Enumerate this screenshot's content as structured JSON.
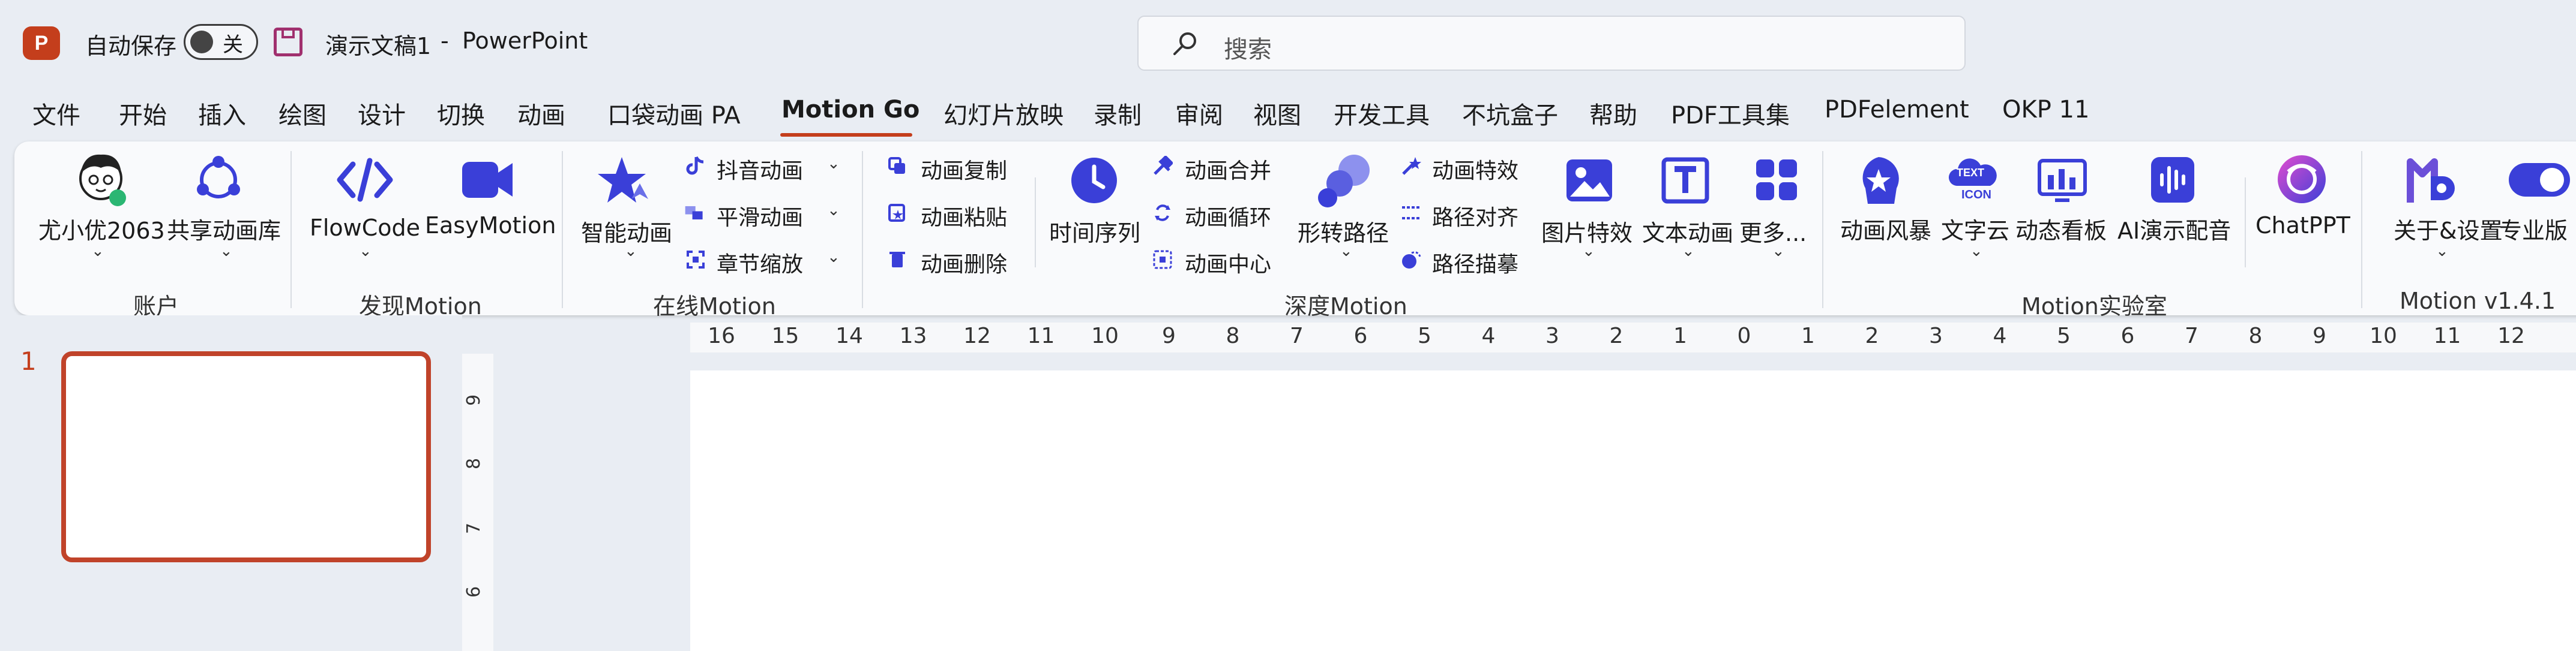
{
  "titlebar": {
    "logo_letter": "P",
    "autosave_label": "自动保存",
    "autosave_toggle": "关",
    "doc_title": "演示文稿1",
    "separator": "-",
    "app_name": "PowerPoint",
    "search_placeholder": "搜索"
  },
  "tabs": [
    "文件",
    "开始",
    "插入",
    "绘图",
    "设计",
    "切换",
    "动画",
    "口袋动画 PA",
    "Motion Go",
    "幻灯片放映",
    "录制",
    "审阅",
    "视图",
    "开发工具",
    "不坑盒子",
    "帮助",
    "PDF工具集",
    "PDFelement",
    "OKP 11"
  ],
  "active_tab": "Motion Go",
  "ribbon": {
    "account": {
      "user": "尤小优2063",
      "library": "共享动画库",
      "group": "账户"
    },
    "discover": {
      "flowcode": "FlowCode",
      "easymotion": "EasyMotion",
      "group": "发现Motion"
    },
    "online": {
      "smart": "智能动画",
      "douyin": "抖音动画",
      "smooth": "平滑动画",
      "chapter": "章节缩放",
      "group": "在线Motion"
    },
    "deep": {
      "copy": "动画复制",
      "paste": "动画粘贴",
      "delete": "动画删除",
      "timeline": "时间序列",
      "merge": "动画合并",
      "loop": "动画循环",
      "center": "动画中心",
      "shape_path": "形转路径",
      "effects": "动画特效",
      "path_align": "路径对齐",
      "path_trace": "路径描摹",
      "image_fx": "图片特效",
      "text_anim": "文本动画",
      "more": "更多...",
      "group": "深度Motion"
    },
    "lab": {
      "storm": "动画风暴",
      "wordcloud": "文字云",
      "dashboard": "动态看板",
      "ai_voice": "AI演示配音",
      "chatppt": "ChatPPT",
      "group": "Motion实验室"
    },
    "version": {
      "about": "关于&设置",
      "pro": "专业版",
      "group": "Motion v1.4.1"
    },
    "wordcloud_icon_text_1": "TEXT",
    "wordcloud_icon_text_2": "ICON"
  },
  "slides": {
    "current_number": "1"
  },
  "ruler": {
    "horizontal": [
      "16",
      "15",
      "14",
      "13",
      "12",
      "11",
      "10",
      "9",
      "8",
      "7",
      "6",
      "5",
      "4",
      "3",
      "2",
      "1",
      "0",
      "1",
      "2",
      "3",
      "4",
      "5",
      "6",
      "7",
      "8",
      "9",
      "10",
      "11",
      "12"
    ],
    "vertical": [
      "9",
      "8",
      "7",
      "6"
    ]
  },
  "colors": {
    "accent": "#c43e1c",
    "motion_blue": "#3a3fd8",
    "save_icon": "#a0306e"
  }
}
